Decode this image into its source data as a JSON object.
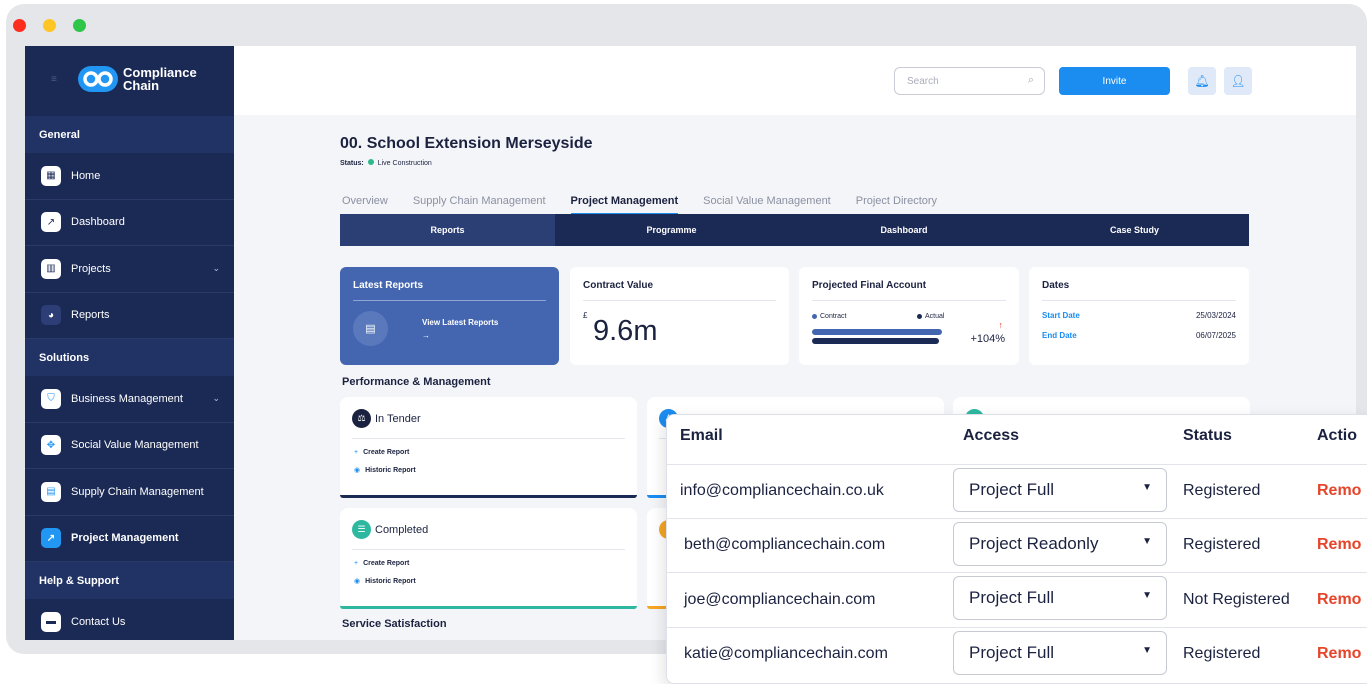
{
  "window": {
    "controls": [
      "close",
      "minimize",
      "maximize"
    ]
  },
  "brand": {
    "line1": "Compliance",
    "line2": "Chain"
  },
  "sidebar": {
    "sections": [
      {
        "title": "General",
        "items": [
          {
            "label": "Home",
            "icon": "grid-icon"
          },
          {
            "label": "Dashboard",
            "icon": "chart-line-icon"
          },
          {
            "label": "Projects",
            "icon": "building-icon",
            "expandable": true
          },
          {
            "label": "Reports",
            "icon": "pie-chart-icon"
          }
        ]
      },
      {
        "title": "Solutions",
        "items": [
          {
            "label": "Business Management",
            "icon": "shield-icon",
            "expandable": true
          },
          {
            "label": "Social Value Management",
            "icon": "handshake-icon"
          },
          {
            "label": "Supply Chain Management",
            "icon": "boxes-icon"
          },
          {
            "label": "Project Management",
            "icon": "project-icon",
            "active": true
          }
        ]
      },
      {
        "title": "Help & Support",
        "items": [
          {
            "label": "Contact Us",
            "icon": "chat-icon"
          }
        ]
      }
    ]
  },
  "topbar": {
    "search_placeholder": "Search",
    "invite_label": "Invite"
  },
  "project": {
    "title": "00. School Extension Merseyside",
    "status_label": "Status:",
    "status_value": "Live Construction",
    "status_color": "#2fb88b"
  },
  "tabs": [
    "Overview",
    "Supply Chain Management",
    "Project Management",
    "Social Value Management",
    "Project Directory"
  ],
  "active_tab": "Project Management",
  "subtabs": [
    "Reports",
    "Programme",
    "Dashboard",
    "Case Study"
  ],
  "cards": {
    "latest": {
      "title": "Latest Reports",
      "link": "View Latest Reports",
      "arrow": "→"
    },
    "contract": {
      "title": "Contract Value",
      "currency": "£",
      "value": "9.6m"
    },
    "pfa": {
      "title": "Projected Final Account",
      "legend_contract": "Contract",
      "legend_actual": "Actual",
      "change": "+104%",
      "contract_share": 0.79,
      "actual_share": 0.77,
      "contract_color": "#4466b1",
      "actual_color": "#1b2955"
    },
    "dates": {
      "title": "Dates",
      "start_label": "Start Date",
      "start_value": "25/03/2024",
      "end_label": "End Date",
      "end_value": "06/07/2025"
    }
  },
  "performance": {
    "title": "Performance & Management",
    "cards": [
      {
        "title": "In Tender",
        "create": "Create Report",
        "historic": "Historic Report",
        "accent": "#1b2955"
      },
      {
        "title": "Completed",
        "create": "Create Report",
        "historic": "Historic Report",
        "accent": "#2fb8a0"
      }
    ]
  },
  "service": {
    "title": "Service Satisfaction"
  },
  "users_table": {
    "headers": {
      "email": "Email",
      "access": "Access",
      "status": "Status",
      "actions": "Actio"
    },
    "rows": [
      {
        "email": "info@compliancechain.co.uk",
        "access": "Project Full",
        "status": "Registered",
        "action": "Remo"
      },
      {
        "email": "beth@compliancechain.com",
        "access": "Project Readonly",
        "status": "Registered",
        "action": "Remo"
      },
      {
        "email": "joe@compliancechain.com",
        "access": "Project Full",
        "status": "Not Registered",
        "action": "Remo"
      },
      {
        "email": "katie@compliancechain.com",
        "access": "Project Full",
        "status": "Registered",
        "action": "Remo"
      }
    ],
    "remove_color": "#e5452b"
  }
}
